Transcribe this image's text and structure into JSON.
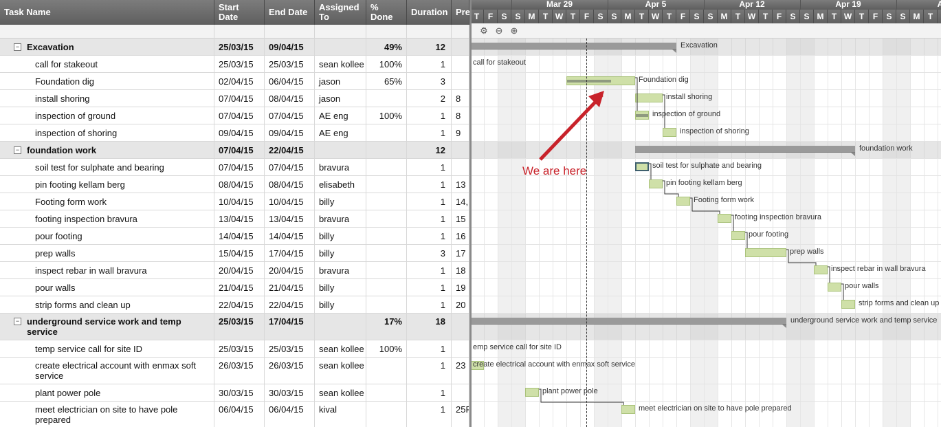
{
  "columns": [
    {
      "key": "name",
      "label": "Task Name"
    },
    {
      "key": "start",
      "label": "Start Date"
    },
    {
      "key": "end",
      "label": "End Date"
    },
    {
      "key": "assigned",
      "label": "Assigned To"
    },
    {
      "key": "pct",
      "label": "% Done"
    },
    {
      "key": "duration",
      "label": "Duration"
    },
    {
      "key": "pred",
      "label": "Pre"
    }
  ],
  "gantt_header": {
    "weeks": [
      "Mar 29",
      "Apr 5",
      "Apr 12",
      "Apr 19",
      "Apr"
    ],
    "days": [
      "T",
      "F",
      "S",
      "S",
      "M",
      "T",
      "W",
      "T",
      "F",
      "S",
      "S",
      "M",
      "T",
      "W",
      "T",
      "F",
      "S",
      "S",
      "M",
      "T",
      "W",
      "T",
      "F",
      "S",
      "S",
      "M",
      "T",
      "W",
      "T",
      "F",
      "S",
      "S",
      "M",
      "T"
    ]
  },
  "toolbar": {
    "icons": [
      "gear-icon",
      "zoom-out-icon",
      "zoom-in-icon"
    ]
  },
  "annotation": {
    "text": "We are here",
    "color": "#c8222a"
  },
  "colors": {
    "bar_fill": "#cfe0a8",
    "group_bar": "#9a9a9a",
    "header": "#6b6b6b"
  },
  "tasks": [
    {
      "name": "Excavation",
      "start": "25/03/15",
      "end": "09/04/15",
      "assigned": "",
      "pct": "49%",
      "duration": "12",
      "pred": "",
      "group": true
    },
    {
      "name": "call for stakeout",
      "start": "25/03/15",
      "end": "25/03/15",
      "assigned": "sean kollee",
      "pct": "100%",
      "duration": "1",
      "pred": ""
    },
    {
      "name": "Foundation dig",
      "start": "02/04/15",
      "end": "06/04/15",
      "assigned": "jason",
      "pct": "65%",
      "duration": "3",
      "pred": ""
    },
    {
      "name": "install shoring",
      "start": "07/04/15",
      "end": "08/04/15",
      "assigned": "jason",
      "pct": "",
      "duration": "2",
      "pred": "8"
    },
    {
      "name": "inspection of ground",
      "start": "07/04/15",
      "end": "07/04/15",
      "assigned": "AE eng",
      "pct": "100%",
      "duration": "1",
      "pred": "8"
    },
    {
      "name": "inspection of shoring",
      "start": "09/04/15",
      "end": "09/04/15",
      "assigned": "AE eng",
      "pct": "",
      "duration": "1",
      "pred": "9"
    },
    {
      "name": "foundation work",
      "start": "07/04/15",
      "end": "22/04/15",
      "assigned": "",
      "pct": "",
      "duration": "12",
      "pred": "",
      "group": true
    },
    {
      "name": "soil test for sulphate and bearing",
      "start": "07/04/15",
      "end": "07/04/15",
      "assigned": "bravura",
      "pct": "",
      "duration": "1",
      "pred": ""
    },
    {
      "name": "pin footing kellam berg",
      "start": "08/04/15",
      "end": "08/04/15",
      "assigned": "elisabeth",
      "pct": "",
      "duration": "1",
      "pred": "13"
    },
    {
      "name": "Footing form work",
      "start": "10/04/15",
      "end": "10/04/15",
      "assigned": "billy",
      "pct": "",
      "duration": "1",
      "pred": "14,"
    },
    {
      "name": "footing inspection bravura",
      "start": "13/04/15",
      "end": "13/04/15",
      "assigned": "bravura",
      "pct": "",
      "duration": "1",
      "pred": "15"
    },
    {
      "name": "pour footing",
      "start": "14/04/15",
      "end": "14/04/15",
      "assigned": "billy",
      "pct": "",
      "duration": "1",
      "pred": "16"
    },
    {
      "name": "prep walls",
      "start": "15/04/15",
      "end": "17/04/15",
      "assigned": "billy",
      "pct": "",
      "duration": "3",
      "pred": "17"
    },
    {
      "name": "inspect rebar in wall bravura",
      "start": "20/04/15",
      "end": "20/04/15",
      "assigned": "bravura",
      "pct": "",
      "duration": "1",
      "pred": "18"
    },
    {
      "name": "pour walls",
      "start": "21/04/15",
      "end": "21/04/15",
      "assigned": "billy",
      "pct": "",
      "duration": "1",
      "pred": "19"
    },
    {
      "name": "strip forms and clean up",
      "start": "22/04/15",
      "end": "22/04/15",
      "assigned": "billy",
      "pct": "",
      "duration": "1",
      "pred": "20"
    },
    {
      "name": "underground service work and temp service",
      "start": "25/03/15",
      "end": "17/04/15",
      "assigned": "",
      "pct": "17%",
      "duration": "18",
      "pred": "",
      "group": true
    },
    {
      "name": "temp service call for site ID",
      "start": "25/03/15",
      "end": "25/03/15",
      "assigned": "sean kollee",
      "pct": "100%",
      "duration": "1",
      "pred": ""
    },
    {
      "name": "create electrical account with enmax soft service",
      "start": "26/03/15",
      "end": "26/03/15",
      "assigned": "sean kollee",
      "pct": "",
      "duration": "1",
      "pred": "23"
    },
    {
      "name": "plant power pole",
      "start": "30/03/15",
      "end": "30/03/15",
      "assigned": "sean kollee",
      "pct": "",
      "duration": "1",
      "pred": ""
    },
    {
      "name": "meet electrician on site to have pole prepared",
      "start": "06/04/15",
      "end": "06/04/15",
      "assigned": "kival",
      "pct": "",
      "duration": "1",
      "pred": "25F"
    }
  ],
  "bar_labels": [
    "Excavation",
    "call for stakeout",
    "Foundation dig",
    "install shoring",
    "inspection of ground",
    "inspection of shoring",
    "foundation work",
    "soil test for sulphate and bearing",
    "pin footing kellam berg",
    "Footing form work",
    "footing inspection bravura",
    "pour footing",
    "prep walls",
    "inspect rebar in wall bravura",
    "pour walls",
    "strip forms and clean up",
    "underground service work and temp service",
    "emp service call for site ID",
    "create electrical account with enmax soft service",
    "plant power pole",
    "meet electrician on site to have pole prepared"
  ]
}
